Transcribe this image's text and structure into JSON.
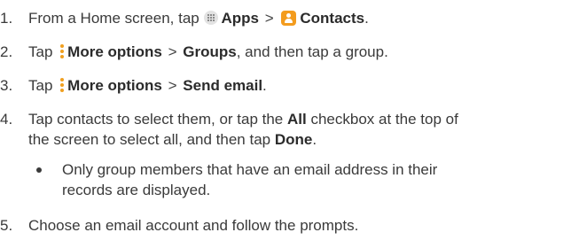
{
  "steps": [
    {
      "number": "1.",
      "prefix": "From a Home screen, tap",
      "apps_label": "Apps",
      "separator": ">",
      "contacts_label": "Contacts",
      "suffix": "."
    },
    {
      "number": "2.",
      "prefix": "Tap",
      "more_options_label": "More options",
      "separator": ">",
      "groups_label": "Groups",
      "suffix": ", and then tap a group."
    },
    {
      "number": "3.",
      "prefix": "Tap",
      "more_options_label": "More options",
      "separator": ">",
      "send_email_label": "Send email",
      "suffix": "."
    },
    {
      "number": "4.",
      "line1_prefix": "Tap contacts to select them, or tap the",
      "all_label": "All",
      "line1_suffix": "checkbox at the top of",
      "line2_prefix": "the screen to select all, and then tap",
      "done_label": "Done",
      "line2_suffix": "."
    },
    {
      "number": "5.",
      "text": "Choose an email account and follow the prompts."
    }
  ],
  "note": {
    "line1": "Only group members that have an email address in their",
    "line2": "records are displayed."
  },
  "icons": {
    "apps": "apps-grid-icon",
    "contacts": "contacts-app-icon",
    "more_options": "more-options-vertical-dots-icon",
    "bullet": "bullet-dot"
  },
  "colors": {
    "text": "#3a3a3a",
    "contacts_icon": "#f39c1e",
    "more_options_icon": "#f0a020",
    "apps_icon": "#e2e2e2"
  }
}
